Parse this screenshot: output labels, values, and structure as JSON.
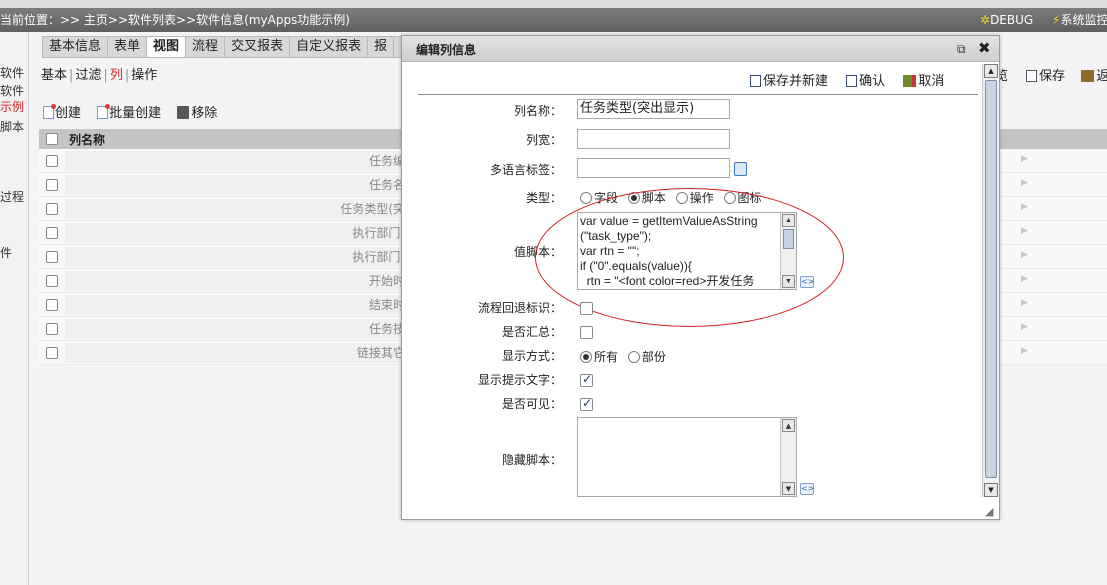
{
  "topbar": {
    "breadcrumb": "当前位置：>> 主页>>软件列表>>软件信息(myApps功能示例)",
    "debug_label": "DEBUG",
    "system_label": "系统监控"
  },
  "left_pane": {
    "items": [
      "软件",
      "软件",
      "示例",
      "脚本",
      "过程",
      "件"
    ]
  },
  "tabs": [
    "基本信息",
    "表单",
    "视图",
    "流程",
    "交叉报表",
    "自定义报表",
    "报"
  ],
  "subnav": {
    "items": [
      "基本",
      "过滤",
      "列",
      "操作"
    ],
    "separator": "|"
  },
  "toolbar": {
    "create": "创建",
    "batch_create": "批量创建",
    "remove": "移除"
  },
  "grid": {
    "header": "列名称",
    "rows": [
      "任务编",
      "任务名",
      "任务类型(突",
      "执行部门(",
      "执行部门(",
      "开始时",
      "结束时",
      "任务技",
      "链接其它"
    ]
  },
  "right_tools": {
    "partial_label": "览",
    "save": "保存",
    "back": "返"
  },
  "dialog": {
    "title": "编辑列信息",
    "actions": {
      "save_and_new": "保存并新建",
      "confirm": "确认",
      "cancel": "取消"
    },
    "fields": {
      "column_name": {
        "label": "列名称：",
        "value": "任务类型(突出显示)"
      },
      "column_width": {
        "label": "列宽：",
        "value": ""
      },
      "multilang_label": {
        "label": "多语言标签：",
        "value": ""
      },
      "type": {
        "label": "类型：",
        "options": [
          "字段",
          "脚本",
          "操作",
          "图标"
        ],
        "selected": "脚本"
      },
      "value_script": {
        "label": "值脚本：",
        "lines": [
          "var value = getItemValueAsString",
          "(\"task_type\");",
          "var rtn = \"\";",
          "if (\"0\".equals(value)){",
          "  rtn = \"<font color=red>开发任务"
        ]
      },
      "flow_back": {
        "label": "流程回退标识：",
        "checked": false
      },
      "summary": {
        "label": "是否汇总：",
        "checked": false
      },
      "display_mode": {
        "label": "显示方式：",
        "options": [
          "所有",
          "部份"
        ],
        "selected": "所有"
      },
      "show_tip": {
        "label": "显示提示文字：",
        "checked": true
      },
      "visible": {
        "label": "是否可见：",
        "checked": true
      },
      "hidden_script": {
        "label": "隐藏脚本：",
        "value": ""
      }
    }
  },
  "colors": {
    "topbar": "#6b6b6b",
    "highlight": "#d02020",
    "grid_header": "#c4c4c4"
  }
}
